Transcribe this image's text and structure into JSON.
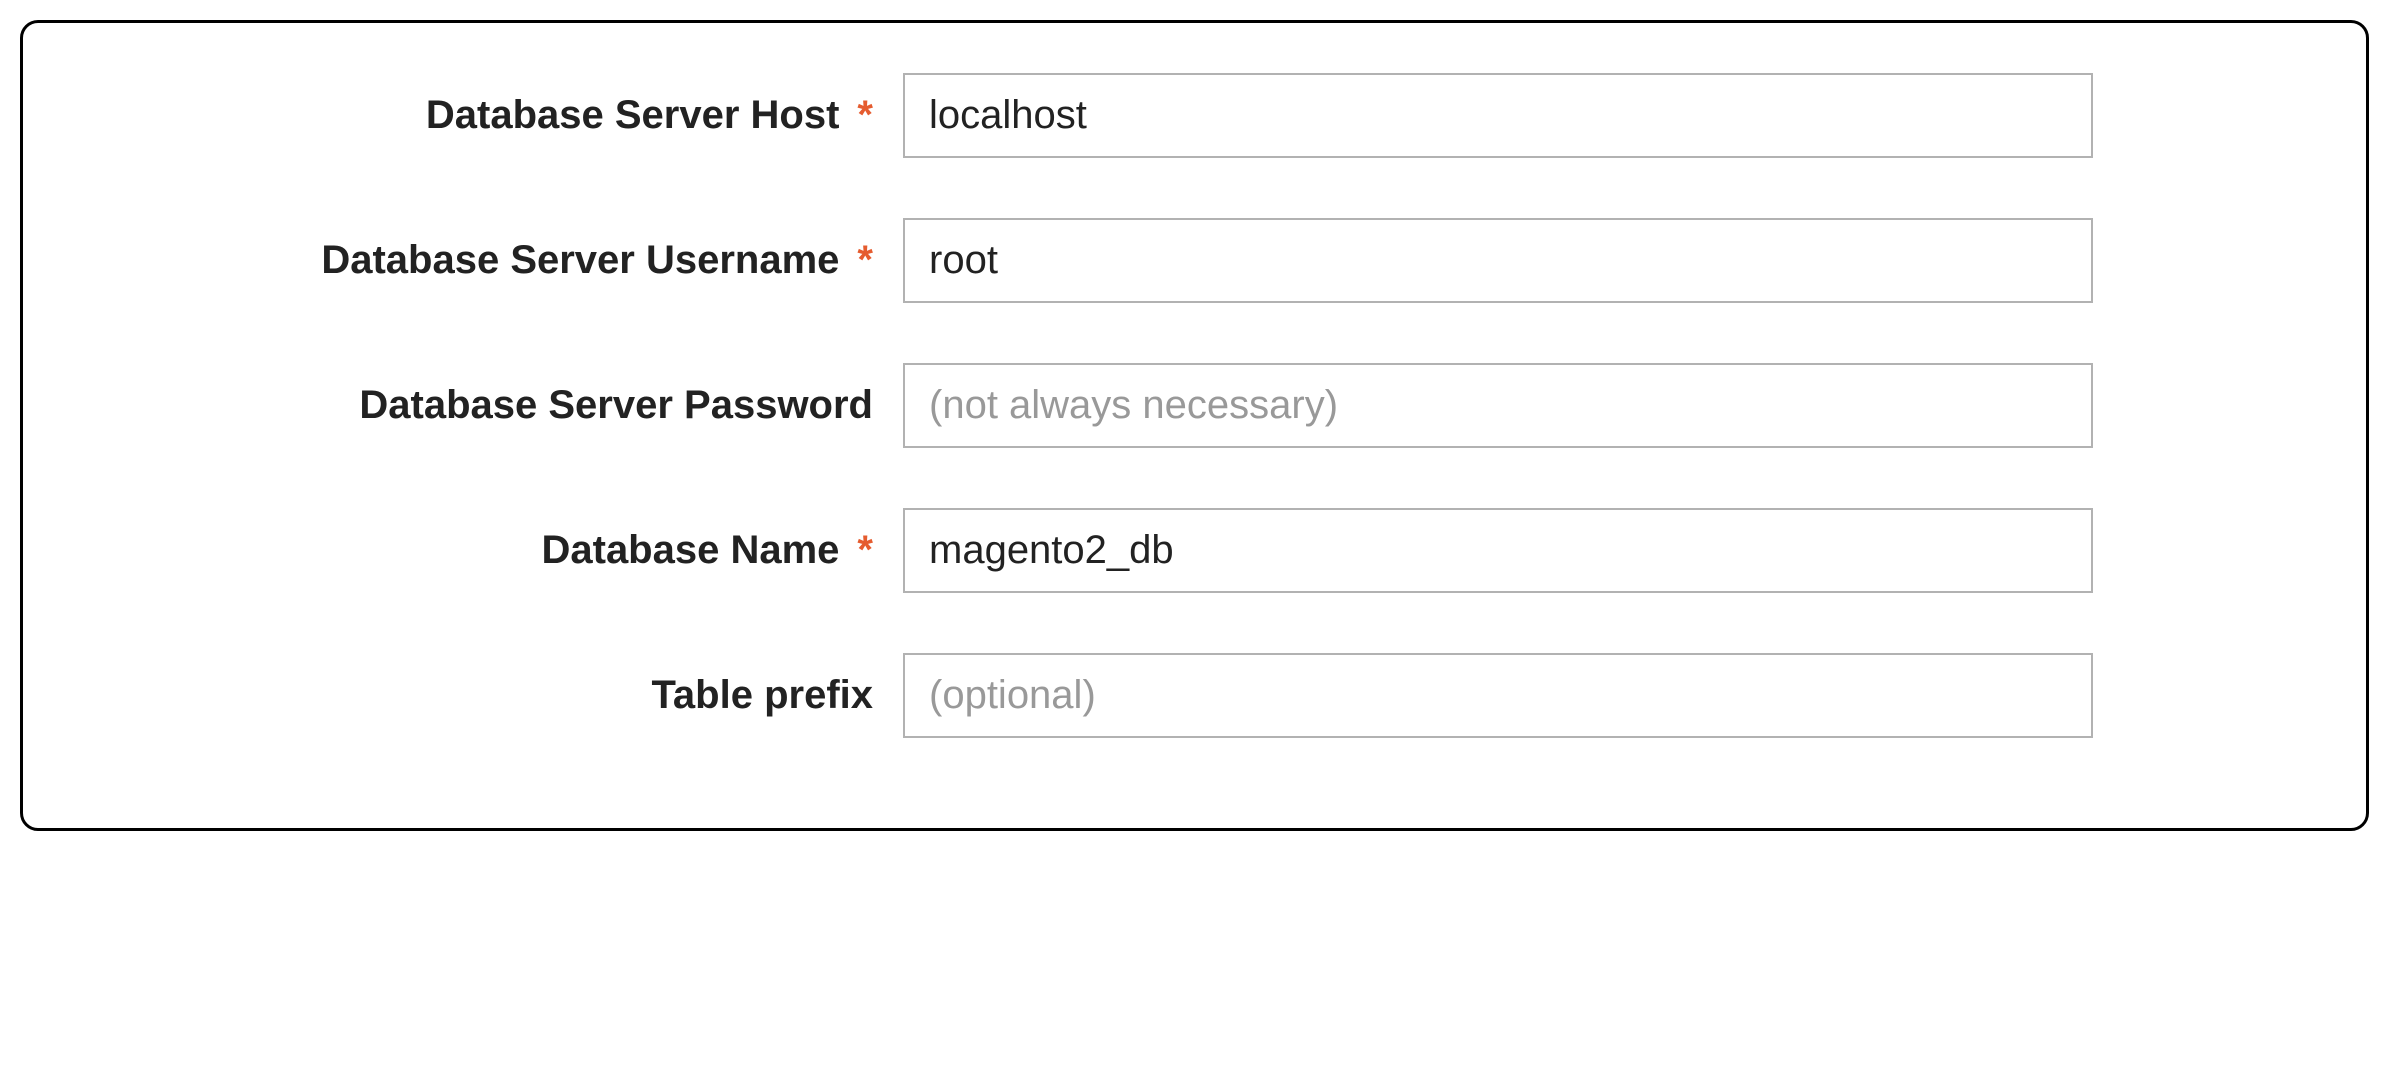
{
  "form": {
    "fields": {
      "db_host": {
        "label": "Database Server Host",
        "required": true,
        "value": "localhost",
        "placeholder": ""
      },
      "db_username": {
        "label": "Database Server Username",
        "required": true,
        "value": "root",
        "placeholder": ""
      },
      "db_password": {
        "label": "Database Server Password",
        "required": false,
        "value": "",
        "placeholder": "(not always necessary)"
      },
      "db_name": {
        "label": "Database Name",
        "required": true,
        "value": "magento2_db",
        "placeholder": ""
      },
      "table_prefix": {
        "label": "Table prefix",
        "required": false,
        "value": "",
        "placeholder": "(optional)"
      }
    },
    "required_symbol": "*"
  }
}
